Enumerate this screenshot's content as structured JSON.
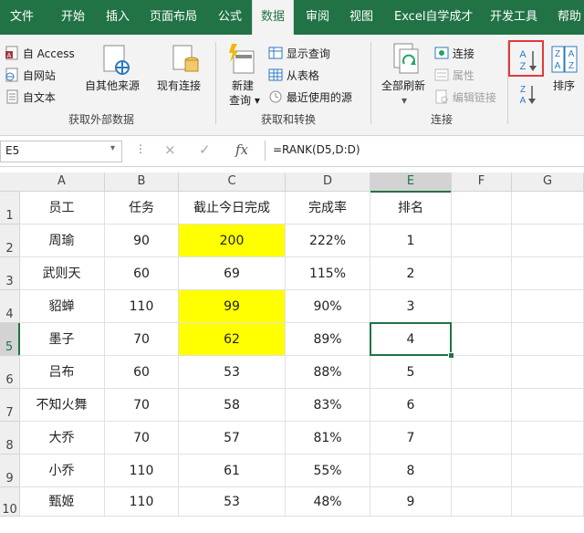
{
  "tabs": [
    "文件",
    "开始",
    "插入",
    "页面布局",
    "公式",
    "数据",
    "审阅",
    "视图",
    "Excel自学成才",
    "开发工具",
    "帮助"
  ],
  "active_tab": "数据",
  "ribbon": {
    "get_external": {
      "from_access": "自 Access",
      "from_web": "自网站",
      "from_text": "自文本",
      "other_sources": "自其他来源",
      "existing_connections": "现有连接",
      "label": "获取外部数据"
    },
    "get_transform": {
      "new_query_line1": "新建",
      "new_query_line2": "查询",
      "show_queries": "显示查询",
      "from_table": "从表格",
      "recent_sources": "最近使用的源",
      "label": "获取和转换"
    },
    "connections": {
      "refresh_all": "全部刷新",
      "connections": "连接",
      "properties": "属性",
      "edit_links": "编辑链接",
      "label": "连接"
    },
    "sort": {
      "sort_label": "排序",
      "highlight_color": "#e03a3a"
    }
  },
  "formula_bar": {
    "name_box": "E5",
    "cancel": "×",
    "enter": "✓",
    "fx": "fx",
    "formula": "=RANK(D5,D:D)"
  },
  "sheet": {
    "columns": [
      "A",
      "B",
      "C",
      "D",
      "E",
      "F",
      "G"
    ],
    "selected_column": "E",
    "rows": [
      "1",
      "2",
      "3",
      "4",
      "5",
      "6",
      "7",
      "8",
      "9",
      "10"
    ],
    "selected_row": "5",
    "active_cell": "E5",
    "fill_color": "#ffff00",
    "data": [
      [
        "员工",
        "任务",
        "截止今日完成",
        "完成率",
        "排名"
      ],
      [
        "周瑜",
        "90",
        "200",
        "222%",
        "1"
      ],
      [
        "武则天",
        "60",
        "69",
        "115%",
        "2"
      ],
      [
        "貂蝉",
        "110",
        "99",
        "90%",
        "3"
      ],
      [
        "墨子",
        "70",
        "62",
        "89%",
        "4"
      ],
      [
        "吕布",
        "60",
        "53",
        "88%",
        "5"
      ],
      [
        "不知火舞",
        "70",
        "58",
        "83%",
        "6"
      ],
      [
        "大乔",
        "70",
        "57",
        "81%",
        "7"
      ],
      [
        "小乔",
        "110",
        "61",
        "55%",
        "8"
      ],
      [
        "甄姬",
        "110",
        "53",
        "48%",
        "9"
      ]
    ],
    "highlighted_cells": [
      "C2",
      "C4",
      "C5"
    ]
  }
}
